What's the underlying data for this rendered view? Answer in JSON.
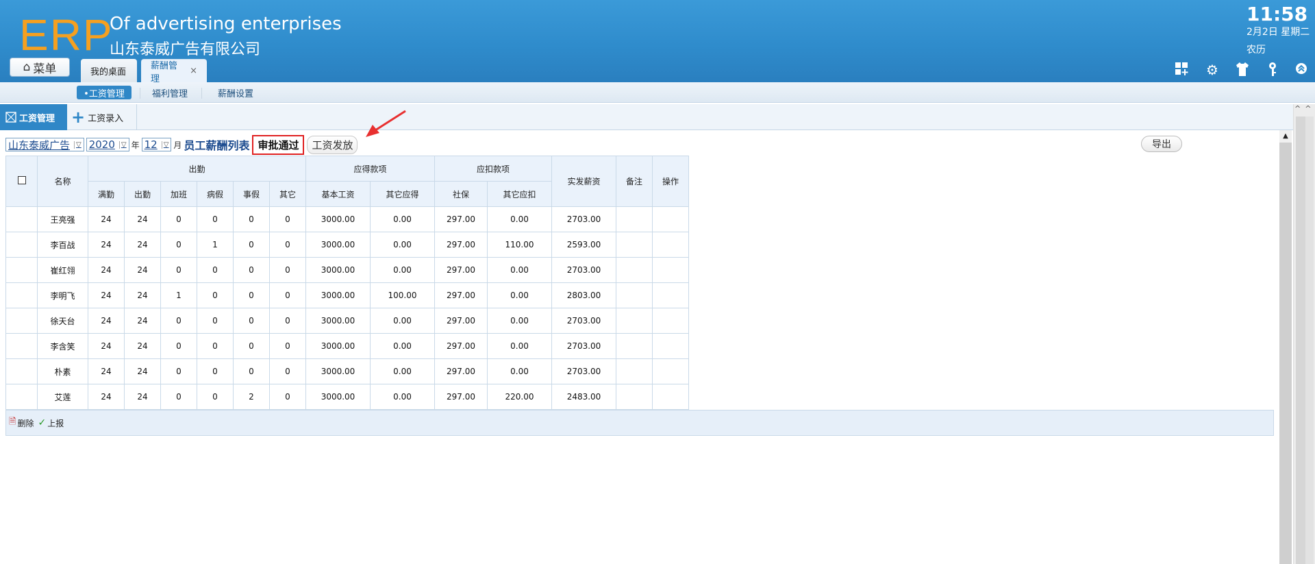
{
  "header": {
    "logo": "ERP",
    "tagline": "Of advertising enterprises",
    "company": "山东泰威广告有限公司",
    "time": "11:58",
    "date": "2月2日 星期二",
    "lunar": "农历",
    "menu_label": "菜单",
    "tabs": [
      {
        "label": "我的桌面"
      },
      {
        "label": "薪酬管理",
        "close": "×"
      }
    ],
    "icons": [
      "grid-add-icon",
      "gear-icon",
      "shirt-icon",
      "key-icon",
      "collapse-icon"
    ]
  },
  "subnav": {
    "items": [
      {
        "label": "•工资管理"
      },
      {
        "label": "福利管理"
      },
      {
        "label": "薪酬设置"
      }
    ]
  },
  "modules": {
    "active": "工资管理",
    "second": "工资录入"
  },
  "filter": {
    "company": "山东泰威广告",
    "year": "2020",
    "year_unit": "年",
    "month": "12",
    "month_unit": "月",
    "title": "员工薪酬列表",
    "status_approved": "审批通过",
    "status_payout": "工资发放",
    "export": "导出"
  },
  "table": {
    "group_headers": {
      "name": "名称",
      "attendance": "出勤",
      "earnings": "应得款项",
      "deductions": "应扣款项",
      "net": "实发薪资",
      "remark": "备注",
      "action": "操作"
    },
    "sub_headers": [
      "满勤",
      "出勤",
      "加班",
      "病假",
      "事假",
      "其它",
      "基本工资",
      "其它应得",
      "社保",
      "其它应扣"
    ],
    "rows": [
      {
        "name": "王亮强",
        "full": "24",
        "att": "24",
        "ot": "0",
        "sick": "0",
        "personal": "0",
        "other": "0",
        "base": "3000.00",
        "other_earn": "0.00",
        "social": "297.00",
        "other_ded": "0.00",
        "net": "2703.00"
      },
      {
        "name": "李百战",
        "full": "24",
        "att": "24",
        "ot": "0",
        "sick": "1",
        "personal": "0",
        "other": "0",
        "base": "3000.00",
        "other_earn": "0.00",
        "social": "297.00",
        "other_ded": "110.00",
        "net": "2593.00"
      },
      {
        "name": "崔红翎",
        "full": "24",
        "att": "24",
        "ot": "0",
        "sick": "0",
        "personal": "0",
        "other": "0",
        "base": "3000.00",
        "other_earn": "0.00",
        "social": "297.00",
        "other_ded": "0.00",
        "net": "2703.00"
      },
      {
        "name": "李明飞",
        "full": "24",
        "att": "24",
        "ot": "1",
        "sick": "0",
        "personal": "0",
        "other": "0",
        "base": "3000.00",
        "other_earn": "100.00",
        "social": "297.00",
        "other_ded": "0.00",
        "net": "2803.00"
      },
      {
        "name": "徐天台",
        "full": "24",
        "att": "24",
        "ot": "0",
        "sick": "0",
        "personal": "0",
        "other": "0",
        "base": "3000.00",
        "other_earn": "0.00",
        "social": "297.00",
        "other_ded": "0.00",
        "net": "2703.00"
      },
      {
        "name": "李含笑",
        "full": "24",
        "att": "24",
        "ot": "0",
        "sick": "0",
        "personal": "0",
        "other": "0",
        "base": "3000.00",
        "other_earn": "0.00",
        "social": "297.00",
        "other_ded": "0.00",
        "net": "2703.00"
      },
      {
        "name": "朴素",
        "full": "24",
        "att": "24",
        "ot": "0",
        "sick": "0",
        "personal": "0",
        "other": "0",
        "base": "3000.00",
        "other_earn": "0.00",
        "social": "297.00",
        "other_ded": "0.00",
        "net": "2703.00"
      },
      {
        "name": "艾莲",
        "full": "24",
        "att": "24",
        "ot": "0",
        "sick": "0",
        "personal": "2",
        "other": "0",
        "base": "3000.00",
        "other_earn": "0.00",
        "social": "297.00",
        "other_ded": "220.00",
        "net": "2483.00"
      }
    ]
  },
  "footer": {
    "delete": "删除",
    "report": "上报"
  },
  "colors": {
    "header_blue": "#2f8ccc",
    "logo_orange": "#f5a020",
    "highlight_red": "#e02020"
  }
}
